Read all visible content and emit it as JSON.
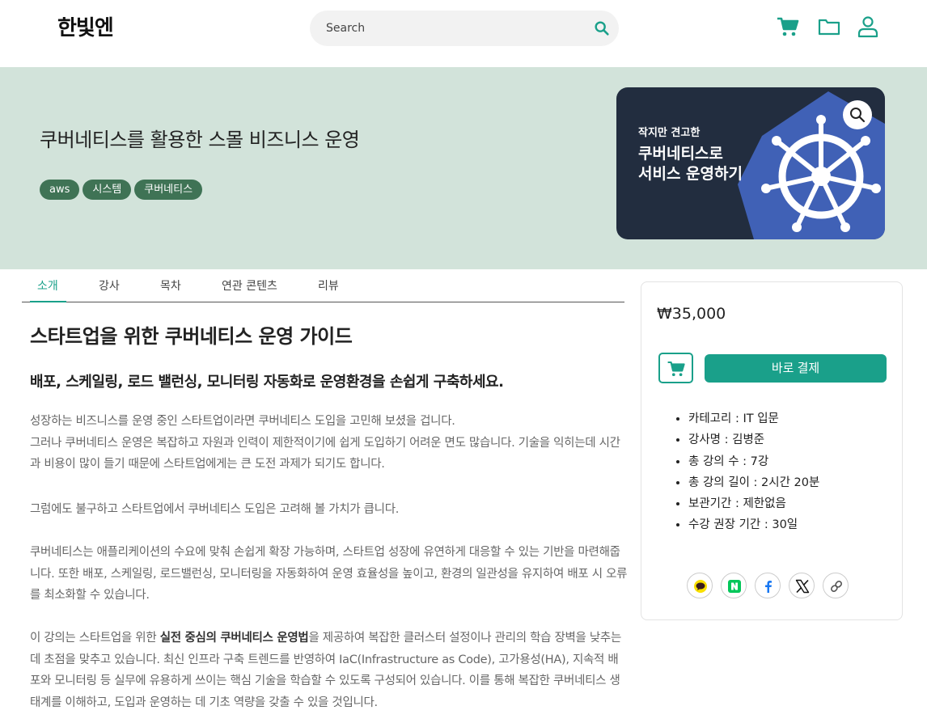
{
  "header": {
    "logo": "한빛엔",
    "search_placeholder": "Search"
  },
  "hero": {
    "title": "쿠버네티스를 활용한 스몰 비즈니스 운영",
    "tags": [
      "aws",
      "시스템",
      "쿠버네티스"
    ],
    "cover": {
      "small": "작지만 견고한",
      "line1": "쿠버네티스로",
      "line2": "서비스 운영하기",
      "bg_color": "#222d3f",
      "hex_color": "#4061b6"
    }
  },
  "tabs": [
    "소개",
    "강사",
    "목차",
    "연관 콘텐츠",
    "리뷰"
  ],
  "active_tab": "소개",
  "main": {
    "heading": "스타트업을 위한 쿠버네티스 운영 가이드",
    "subheading": "배포, 스케일링, 로드 밸런싱, 모니터링 자동화로 운영환경을 손쉽게 구축하세요.",
    "p1_line1": "성장하는 비즈니스를 운영 중인 스타트업이라면 쿠버네티스 도입을 고민해 보셨을 겁니다.",
    "p1_line2": "그러나 쿠버네티스 운영은 복잡하고 자원과 인력이 제한적이기에 쉽게 도입하기 어려운 면도 많습니다. 기술을 익히는데 시간과 비용이 많이 들기 때문에 스타트업에게는 큰 도전 과제가 되기도 합니다.",
    "p2": "그럼에도 불구하고 스타트업에서 쿠버네티스 도입은 고려해 볼 가치가 큽니다.",
    "p3": "쿠버네티스는 애플리케이션의 수요에 맞춰 손쉽게 확장 가능하며, 스타트업 성장에 유연하게 대응할 수 있는 기반을 마련해줍니다. 또한 배포, 스케일링, 로드밸런싱, 모니터링을 자동화하여 운영 효율성을 높이고, 환경의 일관성을 유지하여 배포 시 오류를 최소화할 수 있습니다.",
    "p4_pre": " 이 강의는 스타트업을 위한 ",
    "p4_bold": "실전 중심의 쿠버네티스 운영법",
    "p4_post": "을 제공하여 복잡한 클러스터 설정이나 관리의 학습 장벽을 낮추는 데 초점을 맞추고 있습니다. 최신 인프라 구축 트렌드를 반영하여 IaC(Infrastructure as Code), 고가용성(HA), 지속적 배포와 모니터링 등 실무에 유용하게 쓰이는 핵심 기술을 학습할 수 있도록 구성되어 있습니다. 이를 통해 복잡한 쿠버네티스 생태계를 이해하고, 도입과 운영하는 데 기초 역량을 갖출 수 있을 것입니다."
  },
  "purchase": {
    "price": "₩35,000",
    "buy_label": "바로 결제",
    "info": [
      "카테고리 : IT 입문",
      "강사명 : 김병준",
      "총 강의 수 : 7강",
      "총 강의 길이 : 2시간 20분",
      "보관기간 : 제한없음",
      "수강 권장 기간 : 30일"
    ],
    "accent_color": "#1aa08a"
  }
}
